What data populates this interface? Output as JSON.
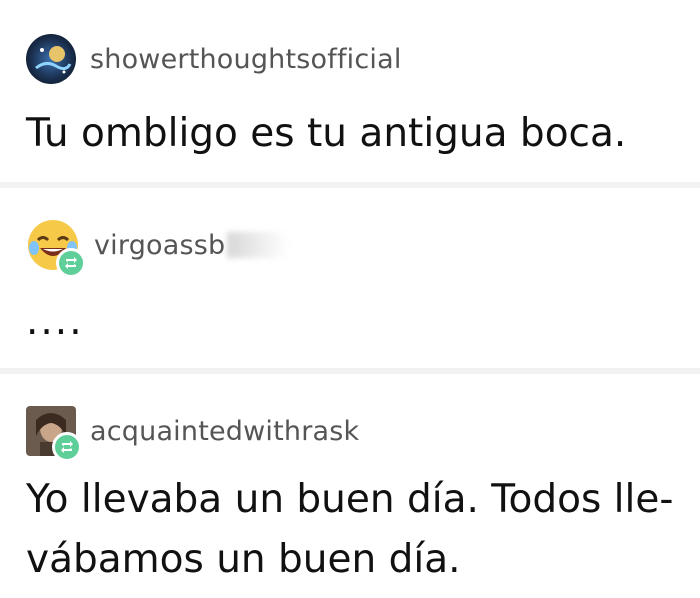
{
  "posts": [
    {
      "username": "showerthoughtsofficial",
      "avatar_icon": "cosmic-avatar-icon",
      "text": "Tu ombligo es tu antigua boca.",
      "reblog": false
    },
    {
      "username": "virgoassb",
      "avatar_icon": "laughing-emoji-avatar-icon",
      "text": "....",
      "reblog": true
    },
    {
      "username": "acquaintedwithrask",
      "avatar_icon": "portrait-avatar-icon",
      "text": "Yo llevaba un buen día. Todos lle-vábamos un buen día.",
      "text_lines": [
        "Yo llevaba un buen día. Todos lle-",
        "vábamos un buen día."
      ],
      "reblog": true
    }
  ],
  "colors": {
    "reblog_badge": "#5fcf9a",
    "username": "#555555",
    "divider": "#f2f2f2"
  }
}
